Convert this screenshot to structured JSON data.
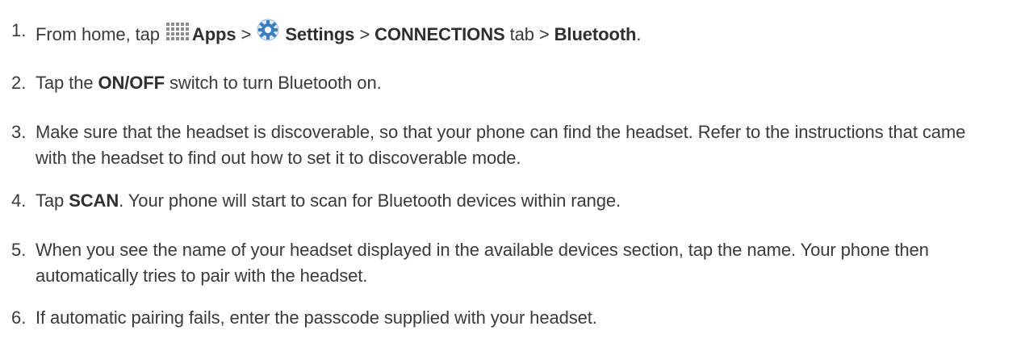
{
  "steps": [
    {
      "num": "1.",
      "t1": "From home, tap ",
      "apps_label": "Apps",
      "t2": " > ",
      "settings_label": "Settings",
      "t3": " > ",
      "connections_label": "CONNECTIONS",
      "t4": " tab > ",
      "bluetooth_label": "Bluetooth",
      "t5": "."
    },
    {
      "num": "2.",
      "t1": "Tap the ",
      "onoff_label": "ON/OFF",
      "t2": " switch to turn Bluetooth on."
    },
    {
      "num": "3.",
      "text": "Make sure that the headset is discoverable, so that your phone can find the headset. Refer to the instructions that came with the headset to find out how to set it to discoverable mode."
    },
    {
      "num": "4.",
      "t1": "Tap ",
      "scan_label": "SCAN",
      "t2": ". Your phone will start to scan for Bluetooth devices within range."
    },
    {
      "num": "5.",
      "text": "When you see the name of your headset displayed in the available devices section, tap the name. Your phone then automatically tries to pair with the headset."
    },
    {
      "num": "6.",
      "text": "If automatic pairing fails, enter the passcode supplied with your headset."
    }
  ],
  "icons": {
    "apps": "apps-grid-icon",
    "settings": "settings-gear-icon",
    "accent_color": "#3a7fc1"
  }
}
